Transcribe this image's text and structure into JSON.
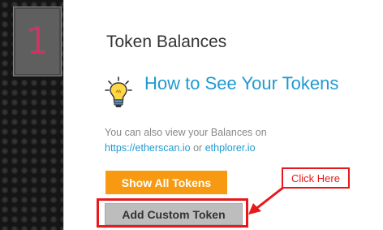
{
  "step": {
    "number": "1"
  },
  "section": {
    "title": "Token Balances"
  },
  "howto": {
    "heading": "How to See Your Tokens",
    "icon": "lightbulb-icon",
    "info_prefix": "You can also view your Balances on",
    "link1": "https://etherscan.io",
    "or": " or ",
    "link2": "ethplorer.io"
  },
  "buttons": {
    "show_all": "Show All Tokens",
    "add_custom": "Add Custom Token"
  },
  "annotation": {
    "callout": "Click Here"
  },
  "colors": {
    "accent": "#1f9ad1",
    "orange": "#f79a12",
    "annotation_red": "#e8191c",
    "step_number": "#e0245e"
  }
}
